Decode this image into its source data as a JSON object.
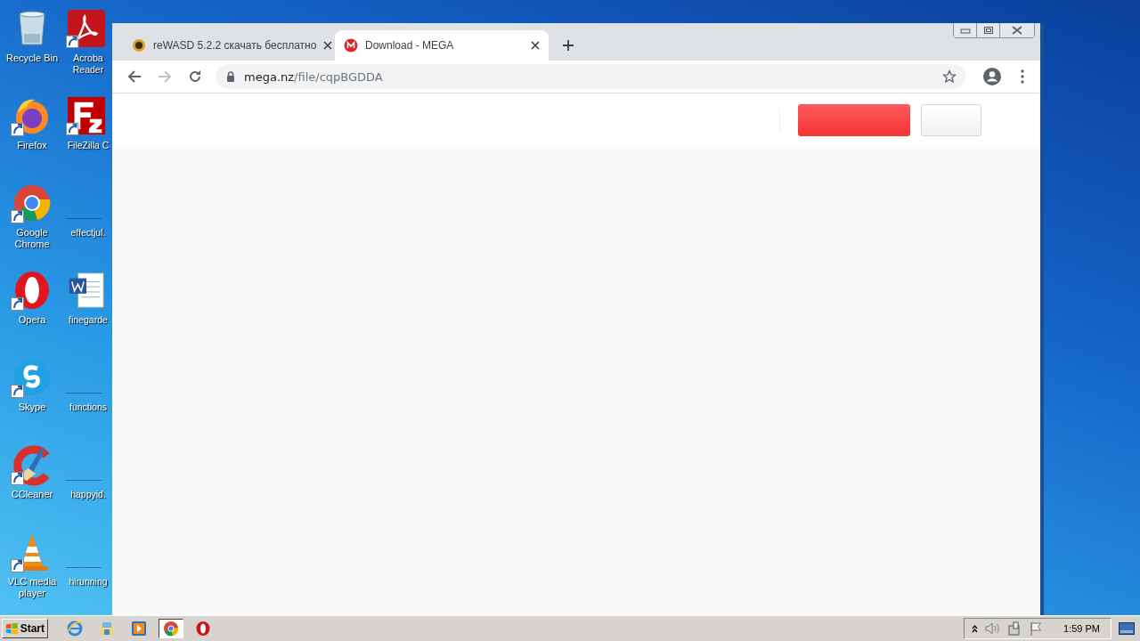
{
  "desktop": {
    "icons": [
      {
        "label": "Recycle Bin",
        "kind": "recycle",
        "shortcut": false
      },
      {
        "label": "Firefox",
        "kind": "firefox",
        "shortcut": true
      },
      {
        "label": "Google Chrome",
        "kind": "chrome",
        "shortcut": true
      },
      {
        "label": "Opera",
        "kind": "opera",
        "shortcut": true
      },
      {
        "label": "Skype",
        "kind": "skype",
        "shortcut": true
      },
      {
        "label": "CCleaner",
        "kind": "ccleaner",
        "shortcut": true
      },
      {
        "label": "VLC media player",
        "kind": "vlc",
        "shortcut": true
      },
      {
        "label": "Acroba Reader",
        "kind": "acrobat",
        "shortcut": true
      },
      {
        "label": "FileZilla C",
        "kind": "filezilla",
        "shortcut": true
      },
      {
        "label": "effectjul.",
        "kind": "file"
      },
      {
        "label": "finegarde",
        "kind": "word",
        "shortcut": false
      },
      {
        "label": "functions",
        "kind": "file"
      },
      {
        "label": "happyid.",
        "kind": "file"
      },
      {
        "label": "hirunning",
        "kind": "file"
      }
    ]
  },
  "browser": {
    "tabs": [
      {
        "title": "reWASD 5.2.2 скачать бесплатно",
        "kind": "sun",
        "selected": false
      },
      {
        "title": "Download - MEGA",
        "kind": "mega",
        "selected": true
      }
    ],
    "forward_disabled": true,
    "url": "mega.nz/file/cqpBGDDA",
    "page": {
      "buttons": [
        {
          "kind": "primary"
        },
        {
          "kind": "secondary"
        }
      ]
    }
  },
  "taskbar": {
    "start": "Start",
    "apps": [
      {
        "kind": "ie",
        "selected": false
      },
      {
        "kind": "explorer",
        "selected": false
      },
      {
        "kind": "media",
        "selected": false
      },
      {
        "kind": "chrome",
        "selected": true
      },
      {
        "kind": "opera",
        "selected": false
      }
    ],
    "clock": "1:59 PM"
  }
}
